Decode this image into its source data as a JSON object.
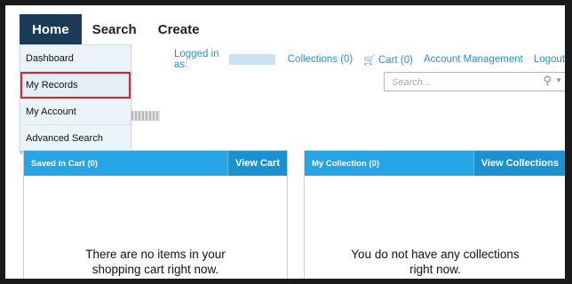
{
  "nav": {
    "tabs": [
      {
        "label": "Home"
      },
      {
        "label": "Search"
      },
      {
        "label": "Create"
      }
    ]
  },
  "dropdown": {
    "items": [
      {
        "label": "Dashboard"
      },
      {
        "label": "My Records"
      },
      {
        "label": "My Account"
      },
      {
        "label": "Advanced Search"
      }
    ]
  },
  "toplinks": {
    "logged_in_label": "Logged in as:",
    "collections": "Collections (0)",
    "cart": "Cart (0)",
    "account": "Account Management",
    "logout": "Logout"
  },
  "search": {
    "placeholder": "Search..."
  },
  "panels": {
    "cart": {
      "title": "Saved in Cart (0)",
      "button": "View Cart",
      "message_line1": "There are no items in your",
      "message_line2": "shopping cart right now."
    },
    "collection": {
      "title": "My Collection (0)",
      "button": "View Collections",
      "message_line1": "You do not have any collections",
      "message_line2": "right now."
    }
  },
  "colors": {
    "nav_active": "#1b3a57",
    "link": "#2b8fd6",
    "panel_header": "#27a4e4",
    "highlight": "#d9232d"
  },
  "icons": [
    "cart-icon",
    "search-icon",
    "dropdown-caret-icon"
  ]
}
